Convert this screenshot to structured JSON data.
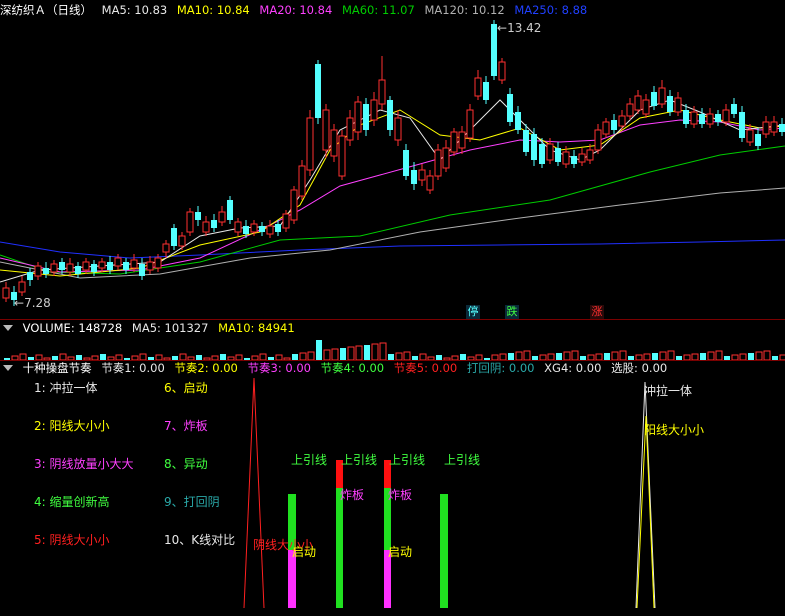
{
  "price_header": {
    "stock_name": "深纺织Ａ（日线）",
    "ma5": "MA5: 10.83",
    "ma10": "MA10: 10.84",
    "ma20": "MA20: 10.84",
    "ma60": "MA60: 11.07",
    "ma120": "MA120: 10.12",
    "ma250": "MA250: 8.88",
    "high_label": "13.42",
    "low_label": "7.28"
  },
  "signals": {
    "ting": "停",
    "die": "跌",
    "zhang": "涨"
  },
  "volume_header": {
    "title": "VOLUME: 148728",
    "ma5": "MA5: 101327",
    "ma10": "MA10: 84941"
  },
  "indicator_header": {
    "name": "十种操盘节奏",
    "r1": "节奏1: 0.00",
    "r2": "节奏2: 0.00",
    "r3": "节奏3: 0.00",
    "r4": "节奏4: 0.00",
    "r5": "节奏5: 0.00",
    "dahuiyin": "打回阴: 0.00",
    "xg4": "XG4: 0.00",
    "xuangu": "选股: 0.00"
  },
  "legend": [
    {
      "text": "1: 冲拉一体",
      "color": "#e8e8e8"
    },
    {
      "text": "2: 阳线大小小",
      "color": "#ffff00"
    },
    {
      "text": "3: 阴线放量小大大",
      "color": "#ff40ff"
    },
    {
      "text": "4: 缩量创新高",
      "color": "#40ff40"
    },
    {
      "text": "5: 阴线大小小",
      "color": "#ff2020"
    },
    {
      "text": "6、启动",
      "color": "#ffff00"
    },
    {
      "text": "7、炸板",
      "color": "#ff40ff"
    },
    {
      "text": "8、异动",
      "color": "#40ff40"
    },
    {
      "text": "9、打回阴",
      "color": "#2aa9a9"
    },
    {
      "text": "10、K线对比",
      "color": "#e8e8e8"
    }
  ],
  "chart_labels": {
    "shangyin1": "上引线",
    "shangyin2": "上引线",
    "shangyin3": "上引线",
    "shangyin4": "上引线",
    "zhaban1": "炸板",
    "zhaban2": "炸板",
    "qidong1": "启动",
    "qidong2": "启动",
    "yinxian": "阴线大小小",
    "chongla": "冲拉一体",
    "yangxian": "阳线大小小"
  },
  "colors": {
    "up": "#ff3030",
    "down": "#54ffff",
    "ma5": "#e8e8e8",
    "ma10": "#ffff00",
    "ma20": "#ff40ff",
    "ma60": "#00cc00",
    "ma120": "#b0b0b0",
    "ma250": "#2030ff",
    "separator": "#7a0000"
  }
}
